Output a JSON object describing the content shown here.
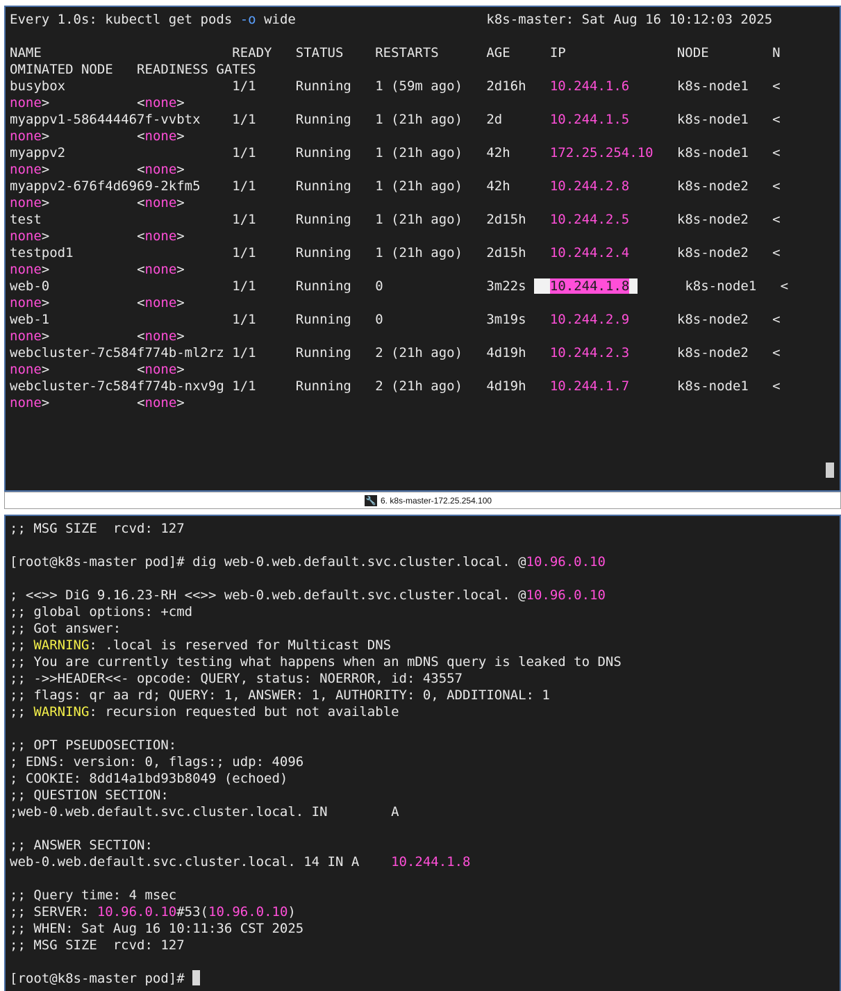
{
  "colors": {
    "terminal_bg": "#1e1e1e",
    "ip_magenta": "#ff4fd8",
    "warning_yellow": "#f4f04a",
    "flag_blue": "#5aa0ff"
  },
  "watch": {
    "header_prefix": "Every 1.0s: kubectl get pods ",
    "header_flag": "-o",
    "header_suffix": " wide",
    "header_right": "k8s-master: Sat Aug 16 10:12:03 2025",
    "columns_line1": "NAME                        READY   STATUS    RESTARTS      AGE     IP              NODE        N",
    "columns_line2": "OMINATED NODE   READINESS GATES",
    "rows": [
      {
        "row": "busybox                     1/1     Running   1 (59m ago)   2d16h   ",
        "ip": "10.244.1.6",
        "tail": "      k8s-node1   <"
      },
      {
        "row": "myappv1-586444467f-vvbtx    1/1     Running   1 (21h ago)   2d      ",
        "ip": "10.244.1.5",
        "tail": "      k8s-node1   <"
      },
      {
        "row": "myappv2                     1/1     Running   1 (21h ago)   42h     ",
        "ip": "172.25.254.10",
        "tail": "   k8s-node1   <"
      },
      {
        "row": "myappv2-676f4d6969-2kfm5    1/1     Running   1 (21h ago)   42h     ",
        "ip": "10.244.2.8",
        "tail": "      k8s-node2   <"
      },
      {
        "row": "test                        1/1     Running   1 (21h ago)   2d15h   ",
        "ip": "10.244.2.5",
        "tail": "      k8s-node2   <"
      },
      {
        "row": "testpod1                    1/1     Running   1 (21h ago)   2d15h   ",
        "ip": "10.244.2.4",
        "tail": "      k8s-node2   <"
      },
      {
        "row": "web-0                       1/1     Running   0             3m22s ",
        "ip": "10.244.1.8",
        "tail": "      k8s-node1   <",
        "highlight": true
      },
      {
        "row": "web-1                       1/1     Running   0             3m19s   ",
        "ip": "10.244.2.9",
        "tail": "      k8s-node2   <"
      },
      {
        "row": "webcluster-7c584f774b-ml2rz 1/1     Running   2 (21h ago)   4d19h   ",
        "ip": "10.244.2.3",
        "tail": "      k8s-node2   <"
      },
      {
        "row": "webcluster-7c584f774b-nxv9g 1/1     Running   2 (21h ago)   4d19h   ",
        "ip": "10.244.1.7",
        "tail": "      k8s-node1   <"
      }
    ],
    "wrap_none1": "none",
    "wrap_gt": ">",
    "wrap_gap": "           ",
    "wrap_lt": "<",
    "wrap_none2": "none"
  },
  "tab": {
    "label": "6. k8s-master-172.25.254.100",
    "icon": "wrench-icon"
  },
  "dig": {
    "line_msgsize_top": ";; MSG SIZE  rcvd: 127",
    "prompt_cmd": "[root@k8s-master pod]# dig web-0.web.default.svc.cluster.local. @",
    "server_ip": "10.96.0.10",
    "banner": "; <<>> DiG 9.16.23-RH <<>> web-0.web.default.svc.cluster.local. @",
    "global_options": ";; global options: +cmd",
    "got_answer": ";; Got answer:",
    "warn_prefix": ";; ",
    "warning_word": "WARNING",
    "warning1_text": ": .local is reserved for Multicast DNS",
    "mdns_line": ";; You are currently testing what happens when an mDNS query is leaked to DNS",
    "header_line": ";; ->>HEADER<<- opcode: QUERY, status: NOERROR, id: 43557",
    "flags_line": ";; flags: qr aa rd; QUERY: 1, ANSWER: 1, AUTHORITY: 0, ADDITIONAL: 1",
    "warning2_text": ": recursion requested but not available",
    "opt_section": ";; OPT PSEUDOSECTION:",
    "edns_line": "; EDNS: version: 0, flags:; udp: 4096",
    "cookie_line": "; COOKIE: 8dd14a1bd93b8049 (echoed)",
    "question_section": ";; QUESTION SECTION:",
    "question_line": ";web-0.web.default.svc.cluster.local. IN        A",
    "answer_section": ";; ANSWER SECTION:",
    "answer_line": "web-0.web.default.svc.cluster.local. 14 IN A    ",
    "answer_ip": "10.244.1.8",
    "query_time": ";; Query time: 4 msec",
    "server_prefix": ";; SERVER: ",
    "server_mid": "#53(",
    "server_end": ")",
    "when_line": ";; WHEN: Sat Aug 16 10:11:36 CST 2025",
    "msg_size": ";; MSG SIZE  rcvd: 127",
    "final_prompt": "[root@k8s-master pod]# "
  }
}
